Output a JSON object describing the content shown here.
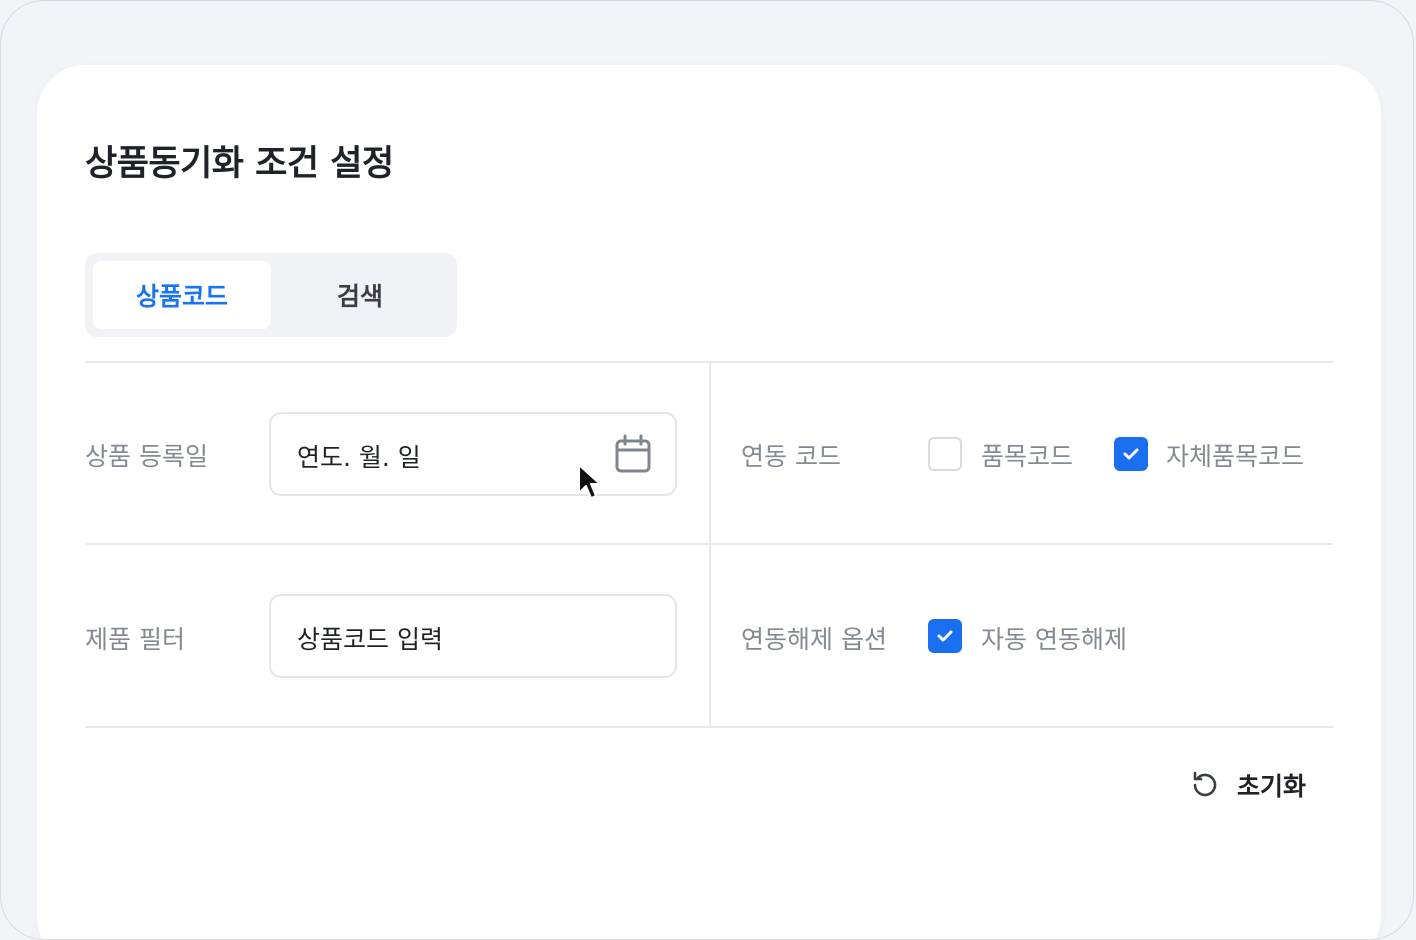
{
  "panel": {
    "title": "상품동기화 조건 설정"
  },
  "segment": {
    "tabs": [
      {
        "label": "상품코드",
        "active": true
      },
      {
        "label": "검색",
        "active": false
      }
    ]
  },
  "form": {
    "reg_date": {
      "label": "상품 등록일",
      "placeholder": "연도. 월. 일"
    },
    "link_code": {
      "label": "연동 코드",
      "options": [
        {
          "label": "품목코드",
          "checked": false
        },
        {
          "label": "자체품목코드",
          "checked": true
        }
      ]
    },
    "product_filter": {
      "label": "제품 필터",
      "placeholder": "상품코드 입력"
    },
    "unlink_option": {
      "label": "연동해제 옵션",
      "options": [
        {
          "label": "자동 연동해제",
          "checked": true
        }
      ]
    }
  },
  "actions": {
    "reset_label": "초기화"
  },
  "colors": {
    "accent": "#1a6ff0",
    "label_gray": "#848a93",
    "border": "#e3e5e9"
  }
}
